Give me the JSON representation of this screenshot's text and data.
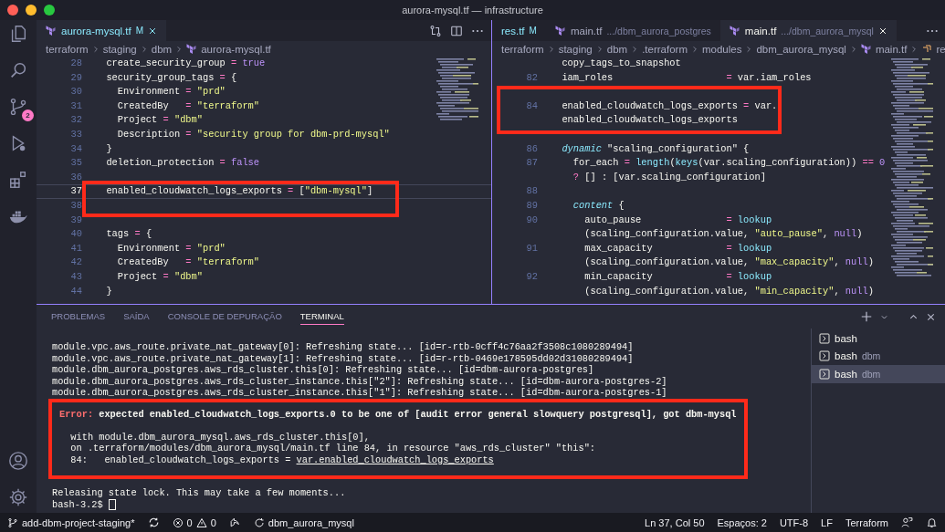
{
  "window": {
    "title": "aurora-mysql.tf — infrastructure"
  },
  "activity_bar": {
    "scm_badge": "2"
  },
  "editors": [
    {
      "kind": "primary",
      "tabs": [
        {
          "label": "aurora-mysql.tf",
          "badge": "M",
          "icon": true,
          "selected": true
        }
      ],
      "breadcrumbs": [
        {
          "label": "terraform",
          "kind": "folder"
        },
        {
          "label": "staging",
          "kind": "folder"
        },
        {
          "label": "dbm",
          "kind": "folder"
        },
        {
          "label": "aurora-mysql.tf",
          "kind": "file"
        }
      ],
      "lines": [
        {
          "num": "28",
          "code": [
            {
              "kind": "plain",
              "text": "  create_security_group "
            },
            {
              "kind": "operator",
              "text": "="
            },
            {
              "kind": "constant",
              "text": " true"
            }
          ]
        },
        {
          "num": "29",
          "code": [
            {
              "kind": "plain",
              "text": "  security_group_tags "
            },
            {
              "kind": "operator",
              "text": "="
            },
            {
              "kind": "plain",
              "text": " {"
            }
          ]
        },
        {
          "num": "30",
          "code": [
            {
              "kind": "plain",
              "text": "    Environment "
            },
            {
              "kind": "operator",
              "text": "="
            },
            {
              "kind": "string",
              "text": " \"prd\""
            }
          ]
        },
        {
          "num": "31",
          "code": [
            {
              "kind": "plain",
              "text": "    CreatedBy   "
            },
            {
              "kind": "operator",
              "text": "="
            },
            {
              "kind": "string",
              "text": " \"terraform\""
            }
          ]
        },
        {
          "num": "32",
          "code": [
            {
              "kind": "plain",
              "text": "    Project "
            },
            {
              "kind": "operator",
              "text": "="
            },
            {
              "kind": "string",
              "text": " \"dbm\""
            }
          ]
        },
        {
          "num": "33",
          "code": [
            {
              "kind": "plain",
              "text": "    Description "
            },
            {
              "kind": "operator",
              "text": "="
            },
            {
              "kind": "string",
              "text": " \"security group for dbm-prd-mysql\""
            }
          ]
        },
        {
          "num": "34",
          "code": [
            {
              "kind": "plain",
              "text": "  }"
            }
          ]
        },
        {
          "num": "35",
          "code": [
            {
              "kind": "plain",
              "text": "  deletion_protection "
            },
            {
              "kind": "operator",
              "text": "="
            },
            {
              "kind": "constant",
              "text": " false"
            }
          ]
        },
        {
          "num": "36"
        },
        {
          "num": "37",
          "current": true,
          "highlighted": true,
          "code": [
            {
              "kind": "plain",
              "text": "  enabled_cloudwatch_logs_exports "
            },
            {
              "kind": "operator",
              "text": "="
            },
            {
              "kind": "plain",
              "text": " ["
            },
            {
              "kind": "string",
              "text": "\"dbm-mysql\""
            },
            {
              "kind": "plain",
              "text": "]"
            }
          ]
        },
        {
          "num": "38"
        },
        {
          "num": "39"
        },
        {
          "num": "40",
          "code": [
            {
              "kind": "plain",
              "text": "  tags "
            },
            {
              "kind": "operator",
              "text": "="
            },
            {
              "kind": "plain",
              "text": " {"
            }
          ]
        },
        {
          "num": "41",
          "code": [
            {
              "kind": "plain",
              "text": "    Environment "
            },
            {
              "kind": "operator",
              "text": "="
            },
            {
              "kind": "string",
              "text": " \"prd\""
            }
          ]
        },
        {
          "num": "42",
          "code": [
            {
              "kind": "plain",
              "text": "    CreatedBy   "
            },
            {
              "kind": "operator",
              "text": "="
            },
            {
              "kind": "string",
              "text": " \"terraform\""
            }
          ]
        },
        {
          "num": "43",
          "code": [
            {
              "kind": "plain",
              "text": "    Project "
            },
            {
              "kind": "operator",
              "text": "="
            },
            {
              "kind": "string",
              "text": " \"dbm\""
            }
          ]
        },
        {
          "num": "44",
          "code": [
            {
              "kind": "plain",
              "text": "  }"
            }
          ]
        }
      ]
    },
    {
      "kind": "secondary",
      "tabs": [
        {
          "label": "res.tf",
          "badge": "M",
          "icon": false,
          "selected": false
        },
        {
          "label": "main.tf",
          "description": ".../dbm_aurora_postgres",
          "icon": true,
          "selected": false
        },
        {
          "label": "main.tf",
          "description": ".../dbm_aurora_mysql",
          "icon": true,
          "selected": true
        }
      ],
      "breadcrumbs": [
        {
          "label": "terraform",
          "kind": "folder"
        },
        {
          "label": "staging",
          "kind": "folder"
        },
        {
          "label": "dbm",
          "kind": "folder"
        },
        {
          "label": ".terraform",
          "kind": "folder"
        },
        {
          "label": "modules",
          "kind": "folder"
        },
        {
          "label": "dbm_aurora_mysql",
          "kind": "folder"
        },
        {
          "label": "main.tf",
          "kind": "file"
        },
        {
          "label": "re",
          "kind": "symbol"
        }
      ],
      "lines": [
        {
          "code": [
            {
              "kind": "plain",
              "text": "  copy_tags_to_snapshot"
            }
          ]
        },
        {
          "num": "82",
          "code": [
            {
              "kind": "plain",
              "text": "  iam_roles                    "
            },
            {
              "kind": "operator",
              "text": "="
            },
            {
              "kind": "plain",
              "text": " var.iam_roles"
            }
          ]
        },
        {
          "num": "84",
          "highlighted": true,
          "code": [
            {
              "kind": "plain",
              "text": "  enabled_cloudwatch_logs_exports "
            },
            {
              "kind": "operator",
              "text": "="
            },
            {
              "kind": "plain",
              "text": " var."
            }
          ],
          "wrap": [
            {
              "kind": "plain",
              "text": "  enabled_cloudwatch_logs_exports"
            }
          ]
        },
        {
          "num": "86",
          "code": [
            {
              "kind": "keyword",
              "text": "  dynamic"
            },
            {
              "kind": "plain",
              "text": " \"scaling_configuration\" {"
            }
          ]
        },
        {
          "num": "87",
          "code": [
            {
              "kind": "plain",
              "text": "    for_each "
            },
            {
              "kind": "operator",
              "text": "="
            },
            {
              "kind": "function",
              "text": " length"
            },
            {
              "kind": "plain",
              "text": "("
            },
            {
              "kind": "function",
              "text": "keys"
            },
            {
              "kind": "plain",
              "text": "(var.scaling_configuration)) "
            },
            {
              "kind": "operator",
              "text": "=="
            },
            {
              "kind": "constant",
              "text": " 0"
            }
          ],
          "wrap": [
            {
              "kind": "operator",
              "text": "    ?"
            },
            {
              "kind": "plain",
              "text": " [] : [var.scaling_configuration]"
            }
          ]
        },
        {
          "num": "88"
        },
        {
          "num": "89",
          "code": [
            {
              "kind": "keyword",
              "text": "    content"
            },
            {
              "kind": "plain",
              "text": " {"
            }
          ]
        },
        {
          "num": "90",
          "code": [
            {
              "kind": "plain",
              "text": "      auto_pause               "
            },
            {
              "kind": "operator",
              "text": "="
            },
            {
              "kind": "function",
              "text": " lookup"
            }
          ],
          "wrap": [
            {
              "kind": "plain",
              "text": "      (scaling_configuration.value, "
            },
            {
              "kind": "string",
              "text": "\"auto_pause\""
            },
            {
              "kind": "plain",
              "text": ", "
            },
            {
              "kind": "constant",
              "text": "null"
            },
            {
              "kind": "plain",
              "text": ")"
            }
          ]
        },
        {
          "num": "91",
          "code": [
            {
              "kind": "plain",
              "text": "      max_capacity             "
            },
            {
              "kind": "operator",
              "text": "="
            },
            {
              "kind": "function",
              "text": " lookup"
            }
          ],
          "wrap": [
            {
              "kind": "plain",
              "text": "      (scaling_configuration.value, "
            },
            {
              "kind": "string",
              "text": "\"max_capacity\""
            },
            {
              "kind": "plain",
              "text": ", "
            },
            {
              "kind": "constant",
              "text": "null"
            },
            {
              "kind": "plain",
              "text": ")"
            }
          ]
        },
        {
          "num": "92",
          "code": [
            {
              "kind": "plain",
              "text": "      min_capacity             "
            },
            {
              "kind": "operator",
              "text": "="
            },
            {
              "kind": "function",
              "text": " lookup"
            }
          ],
          "wrap": [
            {
              "kind": "plain",
              "text": "      (scaling_configuration.value, "
            },
            {
              "kind": "string",
              "text": "\"min_capacity\""
            },
            {
              "kind": "plain",
              "text": ", "
            },
            {
              "kind": "constant",
              "text": "null"
            },
            {
              "kind": "plain",
              "text": ")"
            }
          ]
        }
      ]
    }
  ],
  "panel": {
    "tabs": [
      {
        "label": "PROBLEMAS",
        "selected": false
      },
      {
        "label": "SAÍDA",
        "selected": false
      },
      {
        "label": "CONSOLE DE DEPURAÇÃO",
        "selected": false
      },
      {
        "label": "TERMINAL",
        "selected": true
      }
    ],
    "terminal": {
      "lines": [
        {
          "text": "module.vpc.aws_route.private_nat_gateway[0]: Refreshing state... [id=r-rtb-0cff4c76aa2f3508c1080289494]"
        },
        {
          "text": "module.vpc.aws_route.private_nat_gateway[1]: Refreshing state... [id=r-rtb-0469e178595dd02d31080289494]"
        },
        {
          "text": "module.dbm_aurora_postgres.aws_rds_cluster.this[0]: Refreshing state... [id=dbm-aurora-postgres]"
        },
        {
          "text": "module.dbm_aurora_postgres.aws_rds_cluster_instance.this[\"2\"]: Refreshing state... [id=dbm-aurora-postgres-2]"
        },
        {
          "text": "module.dbm_aurora_postgres.aws_rds_cluster_instance.this[\"1\"]: Refreshing state... [id=dbm-aurora-postgres-1]"
        }
      ],
      "error_lines": [
        {
          "parts": [
            {
              "kind": "error",
              "text": "Error:"
            },
            {
              "kind": "bold",
              "text": " expected enabled_cloudwatch_logs_exports.0 to be one of [audit error general slowquery postgresql], got dbm-mysql"
            }
          ]
        },
        {
          "text": "  with module.dbm_aurora_mysql.aws_rds_cluster.this[0],"
        },
        {
          "text": "  on .terraform/modules/dbm_aurora_mysql/main.tf line 84, in resource \"aws_rds_cluster\" \"this\":"
        },
        {
          "parts": [
            {
              "kind": "plain",
              "text": "  84:   enabled_cloudwatch_logs_exports = "
            },
            {
              "kind": "link",
              "text": "var.enabled_cloudwatch_logs_exports"
            }
          ]
        }
      ],
      "after": [
        {
          "text": "Releasing state lock. This may take a few moments..."
        }
      ],
      "prompt": "bash-3.2$"
    },
    "sessions": [
      {
        "label": "bash",
        "selected": false
      },
      {
        "label": "bash",
        "detail": "dbm",
        "selected": false
      },
      {
        "label": "bash",
        "detail": "dbm",
        "selected": true
      }
    ]
  },
  "status_bar": {
    "branch": "add-dbm-project-staging*",
    "errors": "0",
    "warnings": "0",
    "task": "dbm_aurora_mysql",
    "cursor": "Ln 37, Col 50",
    "indentation": "Espaços: 2",
    "encoding": "UTF-8",
    "eol": "LF",
    "language": "Terraform"
  }
}
